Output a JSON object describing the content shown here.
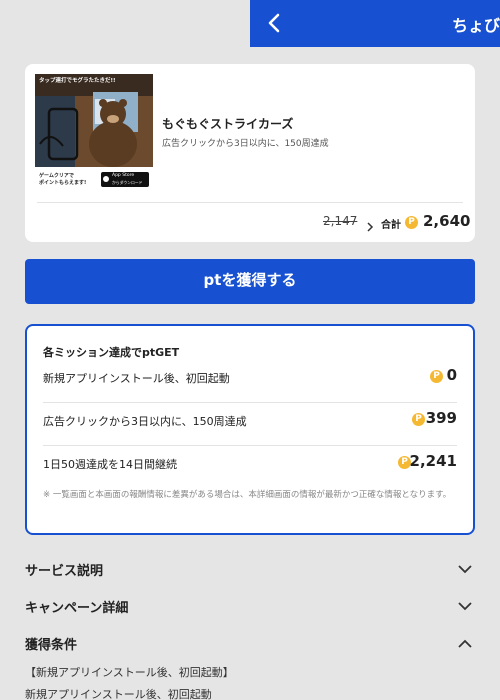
{
  "header": {
    "back_icon": "chevron-left-icon",
    "title": "ちょび"
  },
  "app": {
    "thumb_banner": "タップ連打でモグラたたきだ!!",
    "thumb_caption_1": "ゲームクリアで",
    "thumb_caption_2": "ポイントもらえます!",
    "store_badge_1": "App Store",
    "store_badge_2": "からダウンロード",
    "name": "もぐもぐストライカーズ",
    "description": "広告クリックから3日以内に、150周達成",
    "old_points": "2,147",
    "total_label": "合計",
    "total_points": "2,640"
  },
  "get_button_label": "ptを獲得する",
  "missions": {
    "title": "各ミッション達成でptGET",
    "rows": [
      {
        "label": "新規アプリインストール後、初回起動",
        "points": "0"
      },
      {
        "label": "広告クリックから3日以内に、150周達成",
        "points": "399"
      },
      {
        "label": "1日50週達成を14日間継続",
        "points": "2,241"
      }
    ],
    "note": "※ 一覧画面と本画面の報酬情報に差異がある場合は、本詳細画面の情報が最新かつ正確な情報となります。"
  },
  "sections": {
    "service": "サービス説明",
    "campaign": "キャンペーン詳細",
    "conditions": "獲得条件"
  },
  "conditions": {
    "heading": "【新規アプリインストール後、初回起動】",
    "text": "新規アプリインストール後、初回起動"
  },
  "colors": {
    "primary": "#1750d0",
    "coin": "#f5b833",
    "background": "#e5e5e5"
  }
}
